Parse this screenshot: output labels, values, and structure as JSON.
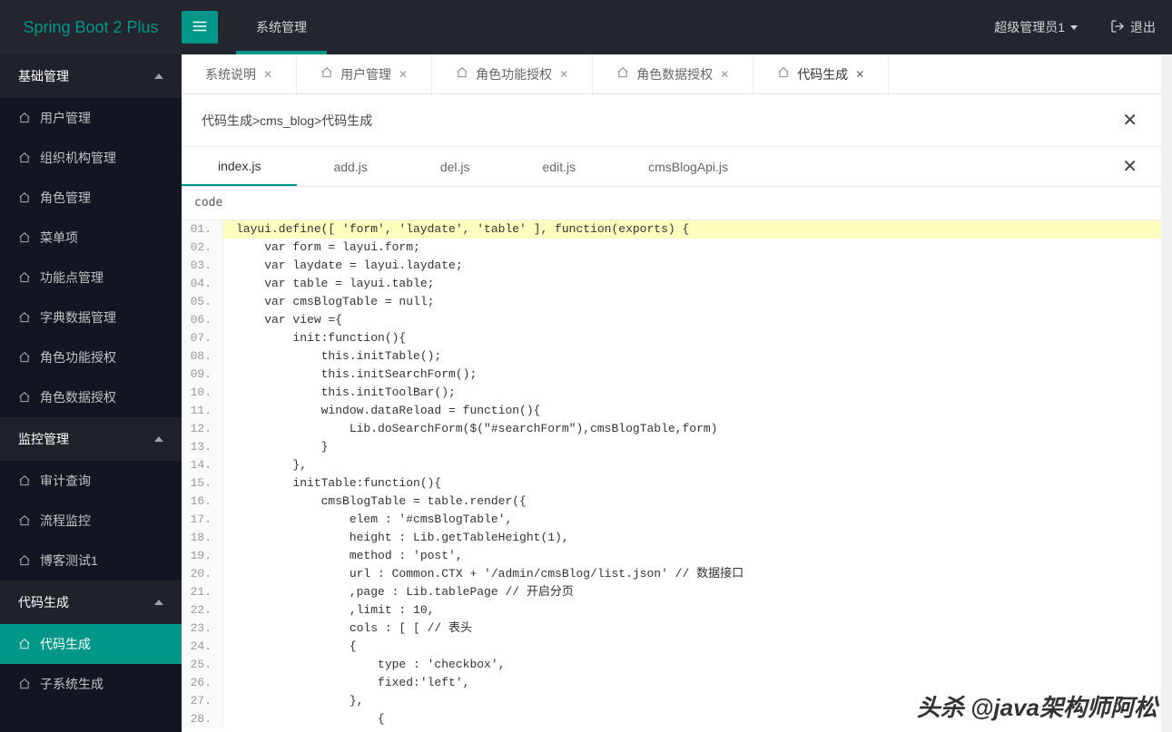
{
  "colors": {
    "accent": "#009688",
    "header": "#23262e",
    "sidebar": "#20222a"
  },
  "header": {
    "logo": "Spring Boot 2 Plus",
    "topnav": {
      "items": [
        {
          "label": "系统管理",
          "active": true
        }
      ]
    },
    "user": "超级管理员1",
    "logout": "退出"
  },
  "sidebar": {
    "groups": [
      {
        "title": "基础管理",
        "items": [
          {
            "label": "用户管理",
            "name": "sidebar-item-users"
          },
          {
            "label": "组织机构管理",
            "name": "sidebar-item-org"
          },
          {
            "label": "角色管理",
            "name": "sidebar-item-roles"
          },
          {
            "label": "菜单项",
            "name": "sidebar-item-menus"
          },
          {
            "label": "功能点管理",
            "name": "sidebar-item-functions"
          },
          {
            "label": "字典数据管理",
            "name": "sidebar-item-dict"
          },
          {
            "label": "角色功能授权",
            "name": "sidebar-item-role-func"
          },
          {
            "label": "角色数据授权",
            "name": "sidebar-item-role-data"
          }
        ]
      },
      {
        "title": "监控管理",
        "items": [
          {
            "label": "审计查询",
            "name": "sidebar-item-audit"
          },
          {
            "label": "流程监控",
            "name": "sidebar-item-flow"
          },
          {
            "label": "博客测试1",
            "name": "sidebar-item-blogtest"
          }
        ]
      },
      {
        "title": "代码生成",
        "items": [
          {
            "label": "代码生成",
            "name": "sidebar-item-codegen",
            "active": true
          },
          {
            "label": "子系统生成",
            "name": "sidebar-item-subsys"
          }
        ]
      }
    ]
  },
  "pagetabs": [
    {
      "label": "系统说明",
      "icon": false,
      "closable": true
    },
    {
      "label": "用户管理",
      "icon": true,
      "closable": true
    },
    {
      "label": "角色功能授权",
      "icon": true,
      "closable": true
    },
    {
      "label": "角色数据授权",
      "icon": true,
      "closable": true
    },
    {
      "label": "代码生成",
      "icon": true,
      "closable": true,
      "active": true
    }
  ],
  "breadcrumb": "代码生成>cms_blog>代码生成",
  "filetabs": [
    {
      "label": "index.js",
      "active": true
    },
    {
      "label": "add.js"
    },
    {
      "label": "del.js"
    },
    {
      "label": "edit.js"
    },
    {
      "label": "cmsBlogApi.js"
    }
  ],
  "code_title": "code",
  "code": {
    "highlight_line": 1,
    "lines": [
      "layui.define([ 'form', 'laydate', 'table' ], function(exports) {",
      "    var form = layui.form;",
      "    var laydate = layui.laydate;",
      "    var table = layui.table;",
      "    var cmsBlogTable = null;",
      "    var view ={",
      "        init:function(){",
      "            this.initTable();",
      "            this.initSearchForm();",
      "            this.initToolBar();",
      "            window.dataReload = function(){",
      "                Lib.doSearchForm($(\"#searchForm\"),cmsBlogTable,form)",
      "            }",
      "        },",
      "        initTable:function(){",
      "            cmsBlogTable = table.render({",
      "                elem : '#cmsBlogTable',",
      "                height : Lib.getTableHeight(1),",
      "                method : 'post',",
      "                url : Common.CTX + '/admin/cmsBlog/list.json' // 数据接口",
      "                ,page : Lib.tablePage // 开启分页",
      "                ,limit : 10,",
      "                cols : [ [ // 表头",
      "                {",
      "                    type : 'checkbox',",
      "                    fixed:'left',",
      "                },",
      "                    {"
    ]
  },
  "watermark": "头杀 @java架构师阿松"
}
